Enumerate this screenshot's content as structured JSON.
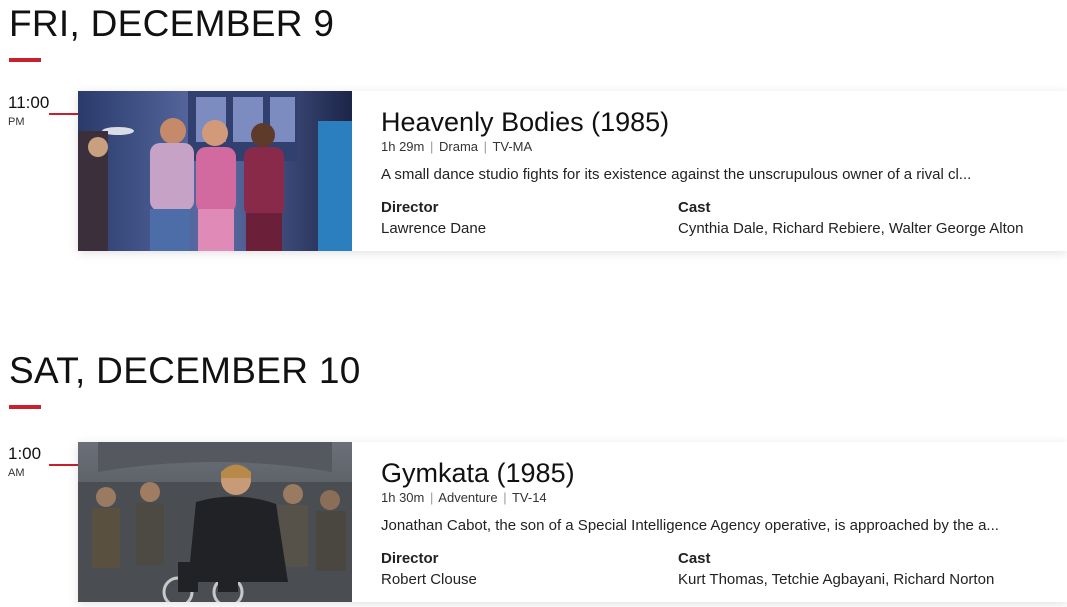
{
  "days": [
    {
      "date": "FRI, DECEMBER 9",
      "time": "11:00",
      "ampm": "PM",
      "movie": {
        "title": "Heavenly Bodies (1985)",
        "runtime": "1h 29m",
        "genre": "Drama",
        "rating": "TV-MA",
        "description": "A small dance studio fights for its existence against the unscrupulous owner of a rival cl...",
        "director_label": "Director",
        "director": "Lawrence Dane",
        "cast_label": "Cast",
        "cast": "Cynthia Dale, Richard Rebiere, Walter George Alton"
      }
    },
    {
      "date": "SAT, DECEMBER 10",
      "time": "1:00",
      "ampm": "AM",
      "movie": {
        "title": "Gymkata (1985)",
        "runtime": "1h 30m",
        "genre": "Adventure",
        "rating": "TV-14",
        "description": "Jonathan Cabot, the son of a Special Intelligence Agency operative, is approached by the a...",
        "director_label": "Director",
        "director": "Robert Clouse",
        "cast_label": "Cast",
        "cast": "Kurt Thomas, Tetchie Agbayani, Richard Norton"
      }
    }
  ],
  "colors": {
    "accent": "#c8202f"
  },
  "separator": "|"
}
